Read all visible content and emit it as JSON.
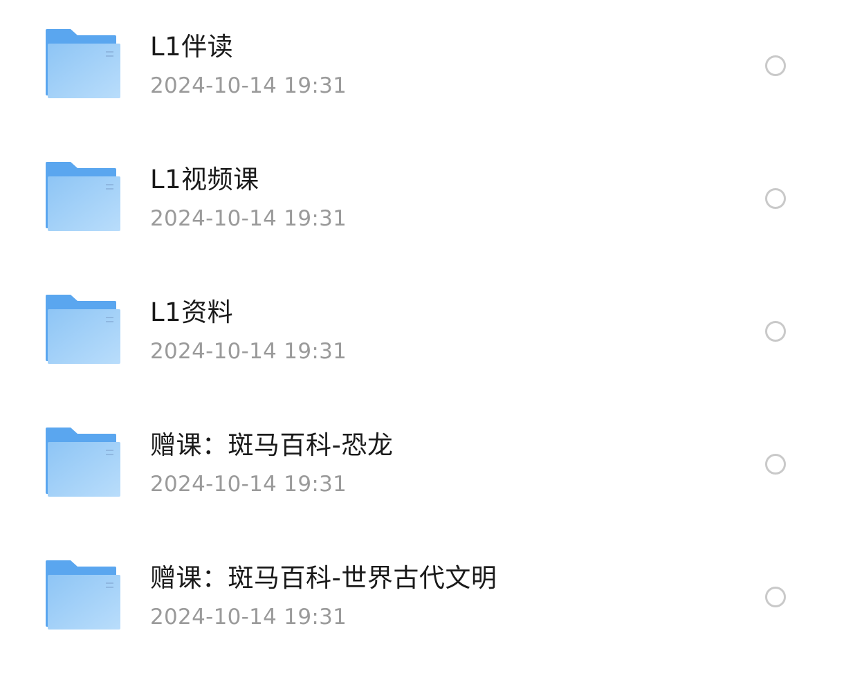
{
  "file_list": {
    "items": [
      {
        "name": "L1伴读",
        "date": "2024-10-14 19:31",
        "icon": "folder-icon",
        "selected": false
      },
      {
        "name": "L1视频课",
        "date": "2024-10-14 19:31",
        "icon": "folder-icon",
        "selected": false
      },
      {
        "name": "L1资料",
        "date": "2024-10-14 19:31",
        "icon": "folder-icon",
        "selected": false
      },
      {
        "name": "赠课：斑马百科-恐龙",
        "date": "2024-10-14 19:31",
        "icon": "folder-icon",
        "selected": false
      },
      {
        "name": "赠课：斑马百科-世界古代文明",
        "date": "2024-10-14 19:31",
        "icon": "folder-icon",
        "selected": false
      }
    ]
  },
  "colors": {
    "folder_back": "#5aa6ef",
    "folder_front_start": "#8ec5f5",
    "folder_front_end": "#b6dcfb",
    "radio_border": "#c9c9c9",
    "name_text": "#1a1a1a",
    "date_text": "#9a9a9a"
  }
}
